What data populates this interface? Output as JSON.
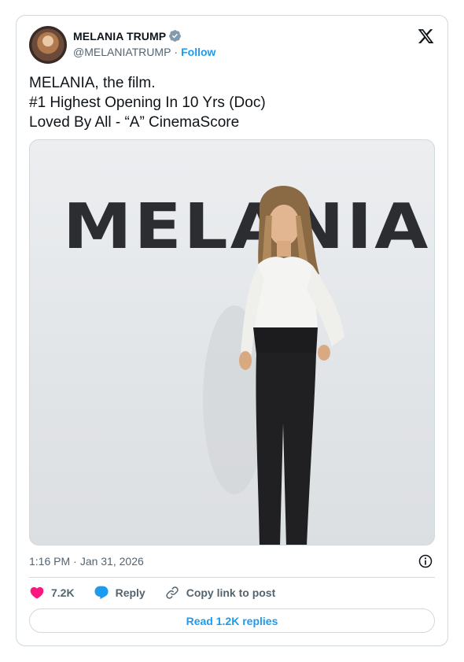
{
  "author": {
    "display_name": "MELANIA TRUMP",
    "handle": "@MELANIATRUMP",
    "separator": "·",
    "follow_label": "Follow"
  },
  "tweet": {
    "lines": [
      "MELANIA, the film.",
      "#1 Highest Opening In 10 Yrs (Doc)",
      "Loved By All - “A” CinemaScore"
    ],
    "image_wall_text": "MELANIA",
    "time": "1:16 PM",
    "date_separator": "·",
    "date": "Jan 31, 2026"
  },
  "actions": {
    "like_count": "7.2K",
    "reply_label": "Reply",
    "copy_link_label": "Copy link to post",
    "read_replies_label": "Read 1.2K replies"
  },
  "colors": {
    "accent": "#1d9bf0",
    "like": "#f91880",
    "secondary_text": "#536471",
    "border": "#cfd9de"
  },
  "icons": {
    "verified": "verified-badge-icon",
    "x_logo": "x-logo-icon",
    "info": "info-icon",
    "heart": "heart-icon",
    "reply": "reply-bubble-icon",
    "link": "link-icon"
  }
}
